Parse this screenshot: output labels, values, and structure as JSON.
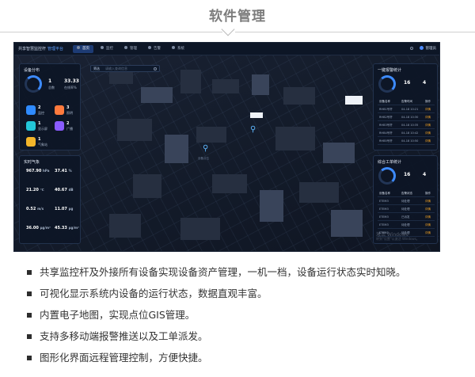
{
  "page": {
    "title": "软件管理"
  },
  "app": {
    "brand": "共享智慧监控杆",
    "brand_sub": "管理平台",
    "nav": [
      {
        "label": "首页",
        "icon": "home-icon",
        "active": true
      },
      {
        "label": "监控",
        "icon": "monitor-icon",
        "active": false
      },
      {
        "label": "管理",
        "icon": "manage-icon",
        "active": false
      },
      {
        "label": "告警",
        "icon": "alarm-icon",
        "active": false
      },
      {
        "label": "系统",
        "icon": "settings-icon",
        "active": false
      }
    ],
    "user": "管理员",
    "search": {
      "label": "筛选",
      "placeholder": "请输入查询信息"
    },
    "left_panel": {
      "title": "设备分布",
      "stats": [
        {
          "value": "1",
          "label": "总数"
        },
        {
          "value": "33.33",
          "label": "在线率%"
        }
      ],
      "tiles": [
        {
          "value": "2",
          "label": "监控",
          "color": "#2f8bff"
        },
        {
          "value": "3",
          "label": "照明",
          "color": "#ff7a3d"
        },
        {
          "value": "1",
          "label": "显示屏",
          "color": "#23c6d8"
        },
        {
          "value": "2",
          "label": "广播",
          "color": "#8a5cff"
        },
        {
          "value": "1",
          "label": "气象站",
          "color": "#f4b62a"
        }
      ]
    },
    "env_panel": {
      "title": "实时气象",
      "rows": [
        {
          "a": "967.90",
          "au": "hPa",
          "b": "37.41",
          "bu": "%"
        },
        {
          "a": "21.20",
          "au": "℃",
          "b": "40.67",
          "bu": "dB"
        },
        {
          "a": "0.52",
          "au": "m/s",
          "b": "11.07",
          "bu": "μg"
        },
        {
          "a": "36.00",
          "au": "μg/m³",
          "b": "45.33",
          "bu": "μg/m³"
        }
      ]
    },
    "right_top": {
      "title": "一键报警统计",
      "stat_a": "16",
      "stat_b": "4",
      "headers": [
        "设备名称",
        "告警时间",
        "操作"
      ],
      "rows": [
        [
          "RHB1号杆",
          "04-18 10:21",
          "详情"
        ],
        [
          "RHB2号杆",
          "04-18 10:30",
          "详情"
        ],
        [
          "RHB3号杆",
          "04-18 10:35",
          "详情"
        ],
        [
          "RHB4号杆",
          "04-18 10:42",
          "详情"
        ],
        [
          "RHB5号杆",
          "04-18 10:50",
          "详情"
        ]
      ]
    },
    "right_bottom": {
      "title": "综合工单统计",
      "stat_a": "16",
      "stat_b": "4",
      "headers": [
        "设备名称",
        "告警状态",
        "操作"
      ],
      "rows": [
        [
          "ETEM3",
          "待处理",
          "详情"
        ],
        [
          "ETEM3",
          "待处理",
          "详情"
        ],
        [
          "ETEM3",
          "已派发",
          "详情"
        ],
        [
          "ETEM3",
          "待处理",
          "详情"
        ],
        [
          "ETEM3",
          "待处理",
          "详情"
        ]
      ]
    },
    "watermark": "激活 Windows",
    "watermark_sub": "转到\"设置\"以激活 Windows。"
  },
  "bullets": [
    "共享监控杆及外接所有设备实现设备资产管理，一机一档，设备运行状态实时知晓。",
    "可视化显示系统内设备的运行状态，数据直观丰富。",
    "内置电子地图，实现点位GIS管理。",
    "支持多移动端报警推送以及工单派发。",
    "图形化界面远程管理控制，方便快捷。"
  ],
  "colors": {
    "accent": "#3d8bff",
    "nav_active": "#1d3b74",
    "warn": "#f5a524"
  }
}
